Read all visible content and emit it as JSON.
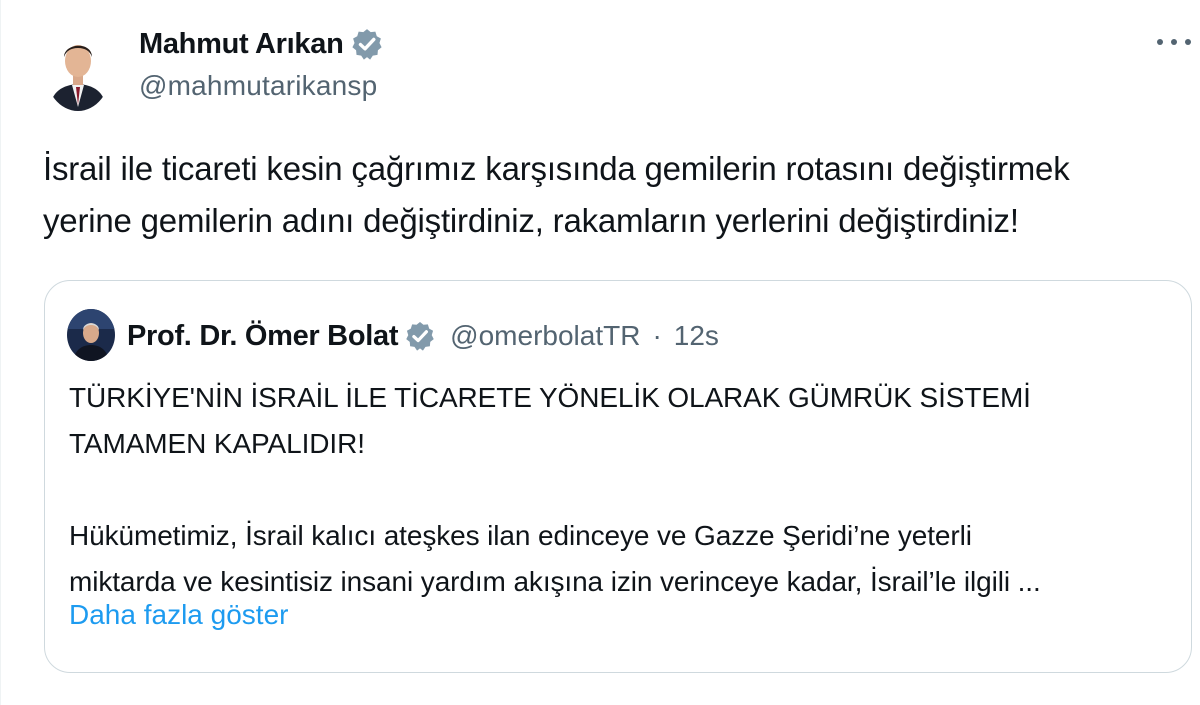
{
  "author": {
    "name": "Mahmut Arıkan",
    "handle": "@mahmutarikansp",
    "verified": true
  },
  "tweet": {
    "lines": [
      "İsrail ile ticareti kesin çağrımız karşısında gemilerin rotasını değiştirmek",
      "yerine gemilerin adını değiştirdiniz, rakamların yerlerini değiştirdiniz!"
    ]
  },
  "quoted": {
    "name": "Prof. Dr. Ömer Bolat",
    "handle": "@omerbolatTR",
    "separator": "·",
    "time": "12s",
    "verified": true,
    "heading_lines": [
      "TÜRKİYE'NİN İSRAİL İLE TİCARETE YÖNELİK OLARAK GÜMRÜK SİSTEMİ",
      "TAMAMEN KAPALIDIR!"
    ],
    "body_lines": [
      "Hükümetimiz, İsrail kalıcı ateşkes ilan edinceye ve Gazze Şeridi’ne yeterli",
      "miktarda ve kesintisiz insani yardım akışına izin verinceye kadar, İsrail’le ilgili ..."
    ],
    "show_more_label": "Daha fazla göster"
  },
  "icons": {
    "verified": "verified-badge-icon",
    "more": "more-dots-icon"
  },
  "colors": {
    "text": "#0f1419",
    "secondary": "#536471",
    "link": "#1d9bf0",
    "border": "#cfd9de",
    "verified_badge": "#829aab"
  }
}
